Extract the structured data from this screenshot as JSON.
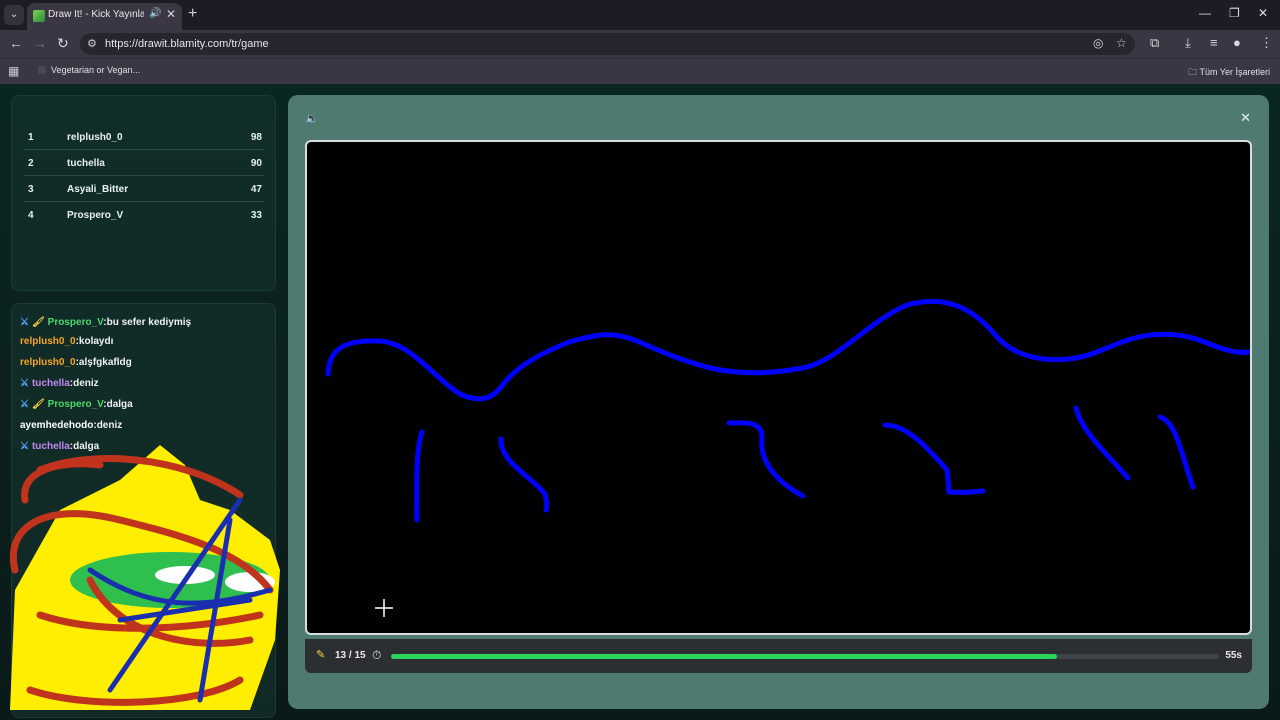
{
  "browser": {
    "tab_title": "Draw It! - Kick Yayınları İçin",
    "url": "https://drawit.blamity.com/tr/game",
    "bookmark_item": "Vegetarian or Vegan...",
    "all_bookmarks": "Tüm Yer İşaretleri"
  },
  "leaderboard": [
    {
      "rank": "1",
      "name": "relplush0_0",
      "score": "98"
    },
    {
      "rank": "2",
      "name": "tuchella",
      "score": "90"
    },
    {
      "rank": "3",
      "name": "Asyali_Bitter",
      "score": "47"
    },
    {
      "rank": "4",
      "name": "Prospero_V",
      "score": "33"
    }
  ],
  "chat": [
    {
      "user": "Prospero_V",
      "message": ":bu sefer kediymiş"
    },
    {
      "user": "relplush0_0",
      "message": ":kolaydı"
    },
    {
      "user": "relplush0_0",
      "message": ":alşfgkafldg"
    },
    {
      "user": "tuchella",
      "message": ":deniz"
    },
    {
      "user": "Prospero_V",
      "message": ":dalga"
    },
    {
      "user": "ayemhedehodo",
      "message": ":deniz"
    },
    {
      "user": "tuchella",
      "message": ":dalga"
    }
  ],
  "game": {
    "round": "13 / 15",
    "time_left": "55s",
    "progress": 0.804
  },
  "icons": {
    "sound": "speaker-icon",
    "close": "close-icon",
    "pencil": "pencil-icon",
    "timer": "stopwatch-icon"
  },
  "colors": {
    "progress": "#2bd45c",
    "stroke": "#0000ff",
    "overlay_red": "#c0341d",
    "overlay_yellow": "#ffee00"
  }
}
